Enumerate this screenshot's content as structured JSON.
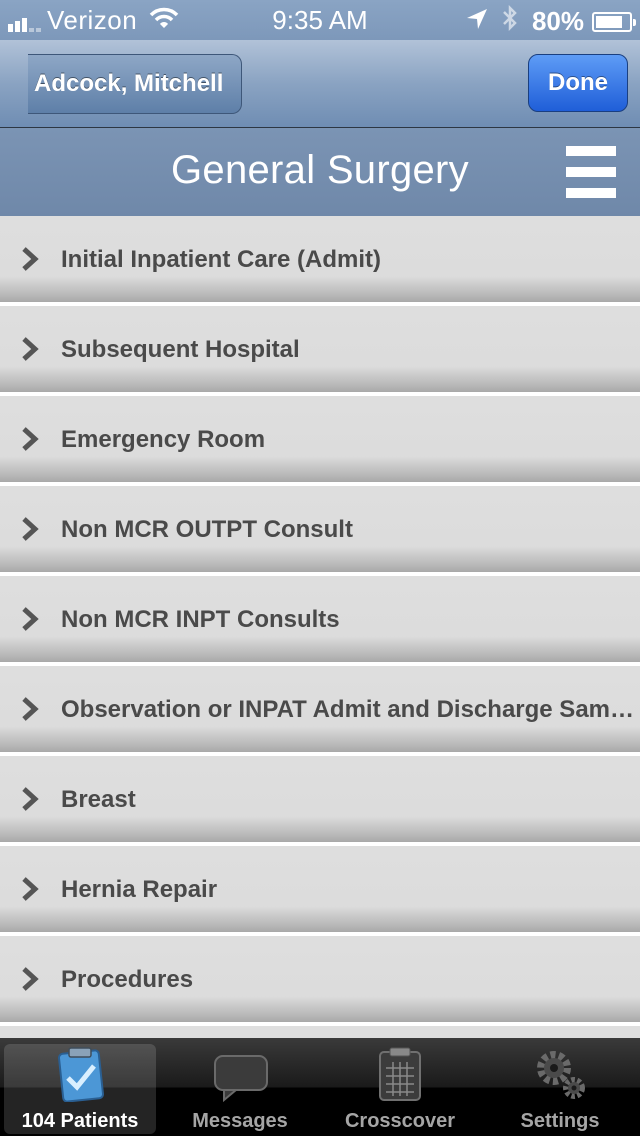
{
  "status_bar": {
    "carrier": "Verizon",
    "time": "9:35 AM",
    "battery": "80%",
    "battery_level": 0.8,
    "icons": [
      "signal-icon",
      "wifi-icon",
      "location-arrow-icon",
      "bluetooth-icon",
      "battery-icon"
    ]
  },
  "nav": {
    "back_label": "Adcock, Mitchell",
    "done_label": "Done"
  },
  "section": {
    "title": "General Surgery",
    "menu_icon": "hamburger-menu-icon"
  },
  "list": {
    "items": [
      {
        "label": "Initial Inpatient Care (Admit)"
      },
      {
        "label": "Subsequent Hospital"
      },
      {
        "label": "Emergency Room"
      },
      {
        "label": "Non MCR OUTPT Consult"
      },
      {
        "label": "Non MCR INPT Consults"
      },
      {
        "label": "Observation or INPAT Admit and Discharge Same…"
      },
      {
        "label": "Breast"
      },
      {
        "label": "Hernia Repair"
      },
      {
        "label": "Procedures"
      }
    ]
  },
  "tabs": [
    {
      "label": "104 Patients",
      "icon": "clipboard-check-icon",
      "active": true
    },
    {
      "label": "Messages",
      "icon": "speech-bubble-icon",
      "active": false
    },
    {
      "label": "Crosscover",
      "icon": "calendar-clipboard-icon",
      "active": false
    },
    {
      "label": "Settings",
      "icon": "gears-icon",
      "active": false
    }
  ],
  "colors": {
    "nav_gradient_top": "#b1c2d8",
    "nav_gradient_bottom": "#6f8db3",
    "section_header": "#7590b1",
    "done_button": "#2a6ae0",
    "list_item_bg": "#dcdcdc",
    "list_text": "#4a4a4a"
  }
}
